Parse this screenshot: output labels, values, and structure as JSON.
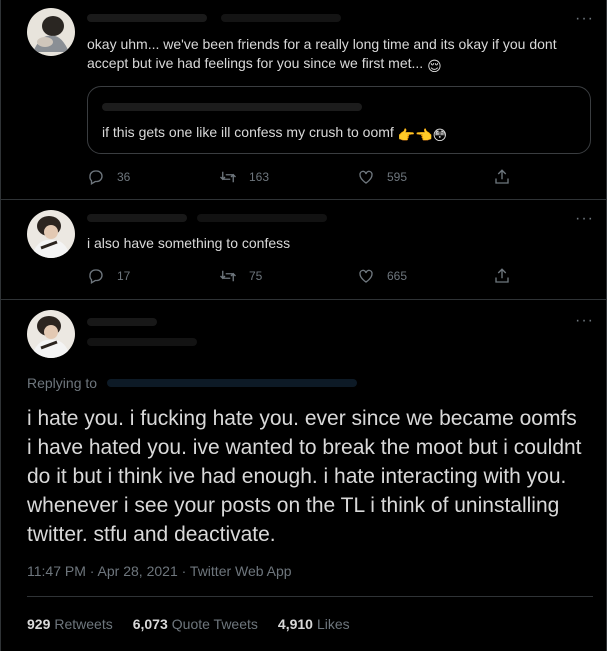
{
  "tweet1": {
    "text": "okay uhm... we've been friends for a really long time and its okay if you dont accept but ive had feelings for you since we first met...",
    "emoji": "😌",
    "quote": {
      "text": "if this gets one like ill confess my crush to oomf",
      "emoji": "👉👈😳"
    },
    "stats": {
      "replies": "36",
      "retweets": "163",
      "likes": "595"
    }
  },
  "tweet2": {
    "text": "i also have something to confess",
    "stats": {
      "replies": "17",
      "retweets": "75",
      "likes": "665"
    }
  },
  "main": {
    "replying_label": "Replying to",
    "text": "i hate you. i fucking hate you. ever since we became oomfs i have hated you. ive wanted to break the moot but i couldnt do it but i think ive had enough. i hate interacting with you. whenever i see your posts on the TL i think of uninstalling twitter. stfu and deactivate.",
    "timestamp": "11:47 PM · Apr 28, 2021 · Twitter Web App",
    "retweets_count": "929",
    "retweets_label": "Retweets",
    "quotes_count": "6,073",
    "quotes_label": "Quote Tweets",
    "likes_count": "4,910",
    "likes_label": "Likes"
  },
  "icons": [
    "reply-icon",
    "retweet-icon",
    "like-icon",
    "share-icon",
    "more-icon"
  ],
  "colors": {
    "background": "#000000",
    "text": "#d9d9d9",
    "muted": "#6e767d",
    "accent": "#1d9bf0",
    "border": "#2f3336"
  }
}
